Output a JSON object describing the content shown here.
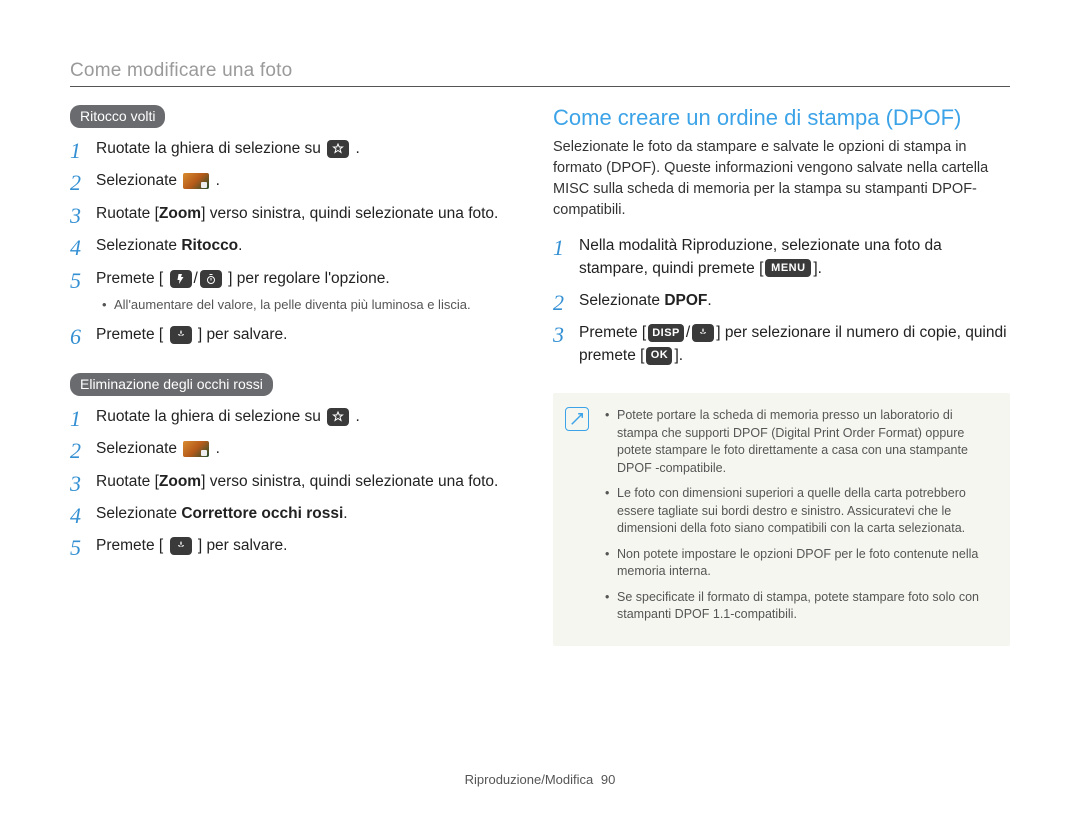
{
  "pageTitle": "Come modificare una foto",
  "left": {
    "section1": {
      "pill": "Ritocco volti"
    },
    "steps1": {
      "s1pre": "Ruotate la ghiera di selezione su ",
      "s1post": ".",
      "s2pre": "Selezionate ",
      "s2post": ".",
      "s3a": "Ruotate [",
      "s3zoom": "Zoom",
      "s3b": "] verso sinistra, quindi selezionate una foto.",
      "s4a": "Selezionate ",
      "s4b": "Ritocco",
      "s4c": ".",
      "s5a": "Premete [",
      "s5mid": "/",
      "s5b": "] per regolare l'opzione.",
      "s5sub": "All'aumentare del valore, la pelle diventa più luminosa e liscia.",
      "s6a": "Premete [",
      "s6b": "] per salvare."
    },
    "section2": {
      "pill": "Eliminazione degli occhi rossi"
    },
    "steps2": {
      "s1pre": "Ruotate la ghiera di selezione su ",
      "s1post": ".",
      "s2pre": "Selezionate ",
      "s2post": ".",
      "s3a": "Ruotate [",
      "s3zoom": "Zoom",
      "s3b": "] verso sinistra, quindi selezionate una foto.",
      "s4a": "Selezionate ",
      "s4b": "Correttore occhi rossi",
      "s4c": ".",
      "s5a": "Premete [",
      "s5b": "] per salvare."
    }
  },
  "right": {
    "title": "Come creare un ordine di stampa (DPOF)",
    "intro": "Selezionate le foto da stampare e salvate le opzioni di stampa in formato (DPOF). Queste informazioni vengono salvate nella cartella MISC sulla scheda di memoria per la stampa su stampanti DPOF-compatibili.",
    "steps": {
      "s1a": "Nella modalità Riproduzione, selezionate una foto da stampare, quindi premete [",
      "s1menu": "MENU",
      "s1b": "].",
      "s2a": "Selezionate ",
      "s2b": "DPOF",
      "s2c": ".",
      "s3a": "Premete [",
      "s3disp": "DISP",
      "s3mid": "/",
      "s3b": "] per selezionare il numero di copie, quindi premete [",
      "s3ok": "OK",
      "s3c": "]."
    },
    "notes": {
      "n1": "Potete portare la scheda di memoria presso un laboratorio di stampa che supporti DPOF (Digital Print Order Format) oppure potete stampare le foto direttamente a casa con una stampante DPOF -compatibile.",
      "n2": "Le foto con dimensioni superiori a quelle della carta potrebbero essere tagliate sui bordi destro e sinistro. Assicuratevi che le dimensioni della foto siano compatibili con la carta selezionata.",
      "n3": "Non potete impostare le opzioni DPOF per le foto contenute nella memoria interna.",
      "n4": "Se specificate il formato di stampa, potete stampare foto solo con stampanti DPOF 1.1-compatibili."
    }
  },
  "footer": {
    "section": "Riproduzione/Modifica",
    "page": "90"
  }
}
